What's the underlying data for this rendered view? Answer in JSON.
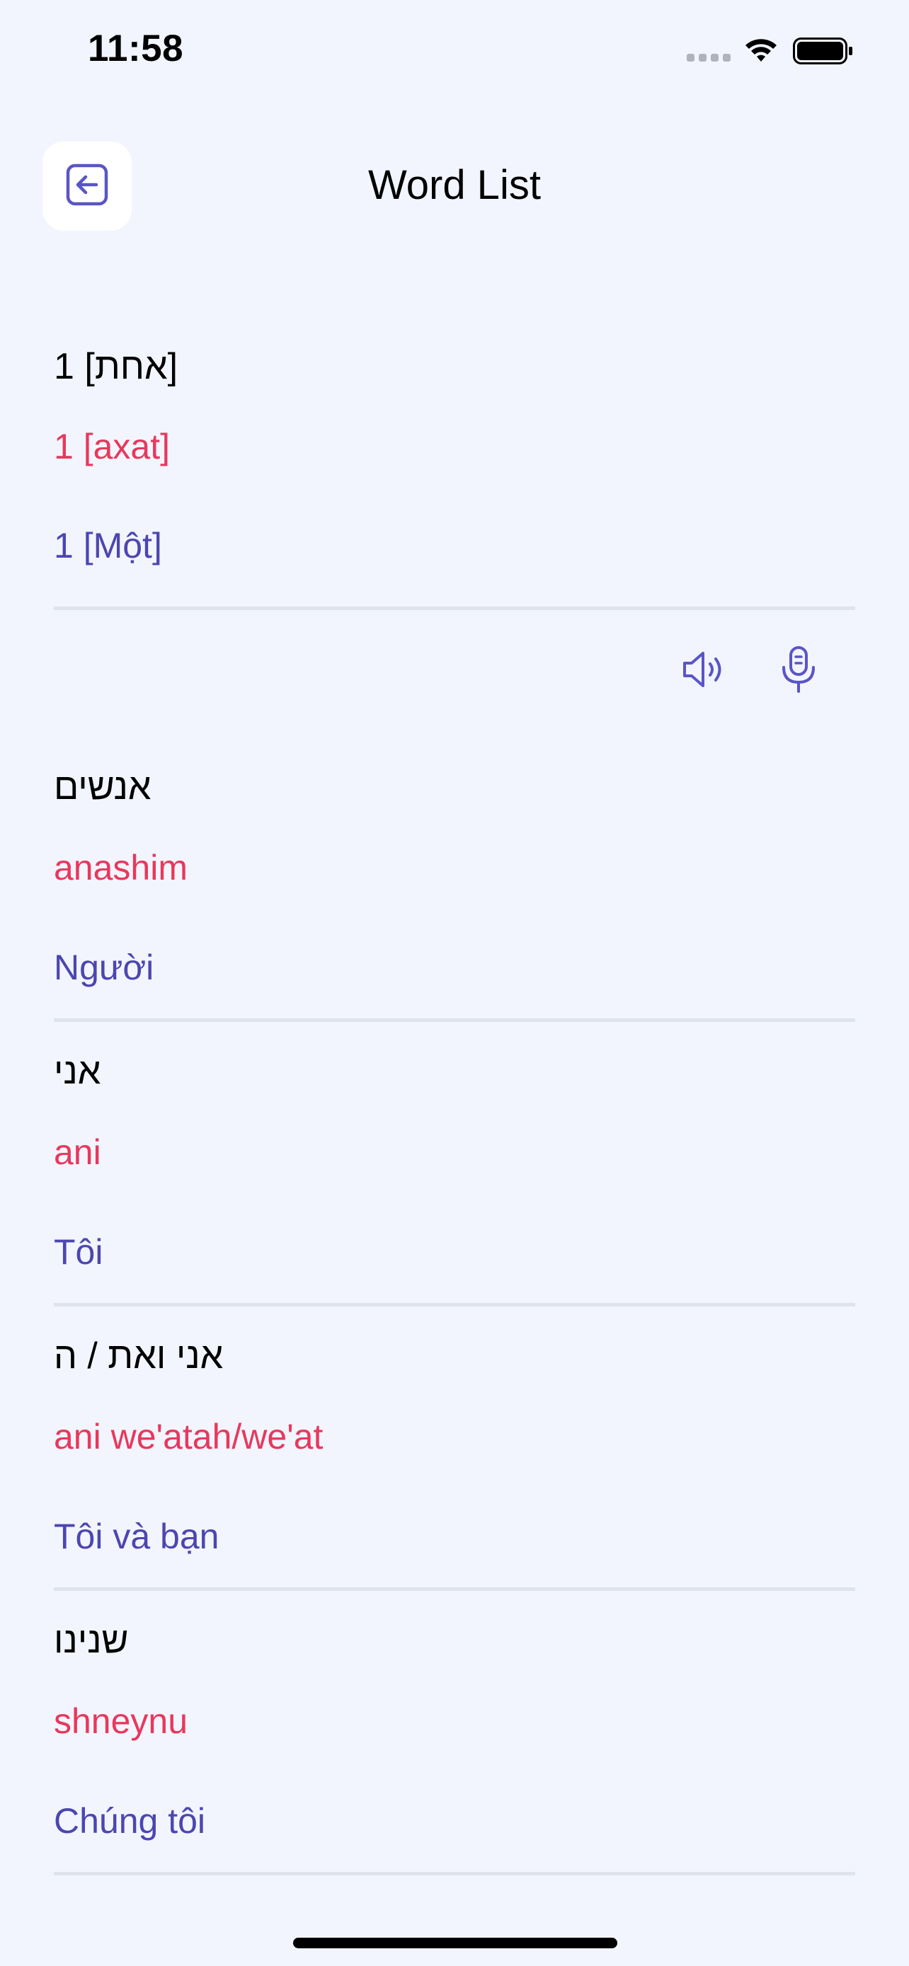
{
  "status_bar": {
    "time": "11:58",
    "signal_icon": "cellular-signal-icon",
    "wifi_icon": "wifi-icon",
    "battery_icon": "battery-icon"
  },
  "header": {
    "back_icon": "arrow-left-square-icon",
    "title": "Word List"
  },
  "colors": {
    "background": "#f2f5fd",
    "transliteration": "#e8385d",
    "translation": "#4c46b0",
    "accent": "#5a55c6",
    "divider": "#dfe3ee"
  },
  "actions": {
    "speaker_icon": "speaker-icon",
    "microphone_icon": "microphone-icon"
  },
  "words": [
    {
      "original": "1 [אחת]",
      "transliteration": "1 [axat]",
      "translation": "1 [Một]"
    },
    {
      "original": "אנשים",
      "transliteration": "anashim",
      "translation": "Người"
    },
    {
      "original": "אני",
      "transliteration": "ani",
      "translation": "Tôi"
    },
    {
      "original": "אני ואת / ה",
      "transliteration": "ani we'atah/we'at",
      "translation": "Tôi và bạn"
    },
    {
      "original": "שנינו",
      "transliteration": "shneynu",
      "translation": "Chúng tôi"
    }
  ]
}
